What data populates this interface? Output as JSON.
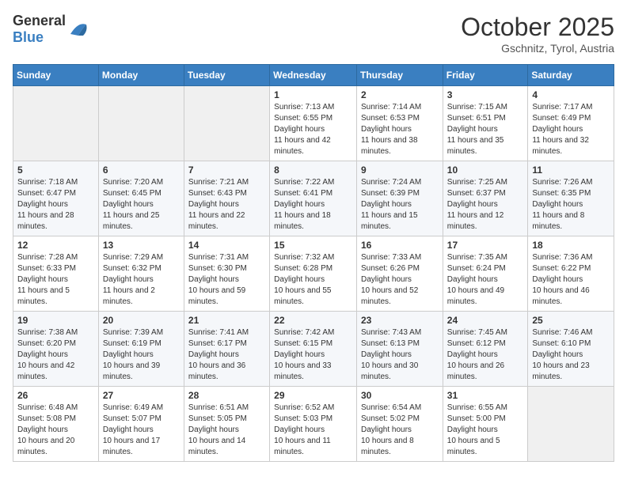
{
  "header": {
    "logo_general": "General",
    "logo_blue": "Blue",
    "month_title": "October 2025",
    "subtitle": "Gschnitz, Tyrol, Austria"
  },
  "calendar": {
    "weekdays": [
      "Sunday",
      "Monday",
      "Tuesday",
      "Wednesday",
      "Thursday",
      "Friday",
      "Saturday"
    ],
    "rows": [
      [
        {
          "day": "",
          "empty": true
        },
        {
          "day": "",
          "empty": true
        },
        {
          "day": "",
          "empty": true
        },
        {
          "day": "1",
          "sunrise": "7:13 AM",
          "sunset": "6:55 PM",
          "daylight": "11 hours and 42 minutes."
        },
        {
          "day": "2",
          "sunrise": "7:14 AM",
          "sunset": "6:53 PM",
          "daylight": "11 hours and 38 minutes."
        },
        {
          "day": "3",
          "sunrise": "7:15 AM",
          "sunset": "6:51 PM",
          "daylight": "11 hours and 35 minutes."
        },
        {
          "day": "4",
          "sunrise": "7:17 AM",
          "sunset": "6:49 PM",
          "daylight": "11 hours and 32 minutes."
        }
      ],
      [
        {
          "day": "5",
          "sunrise": "7:18 AM",
          "sunset": "6:47 PM",
          "daylight": "11 hours and 28 minutes."
        },
        {
          "day": "6",
          "sunrise": "7:20 AM",
          "sunset": "6:45 PM",
          "daylight": "11 hours and 25 minutes."
        },
        {
          "day": "7",
          "sunrise": "7:21 AM",
          "sunset": "6:43 PM",
          "daylight": "11 hours and 22 minutes."
        },
        {
          "day": "8",
          "sunrise": "7:22 AM",
          "sunset": "6:41 PM",
          "daylight": "11 hours and 18 minutes."
        },
        {
          "day": "9",
          "sunrise": "7:24 AM",
          "sunset": "6:39 PM",
          "daylight": "11 hours and 15 minutes."
        },
        {
          "day": "10",
          "sunrise": "7:25 AM",
          "sunset": "6:37 PM",
          "daylight": "11 hours and 12 minutes."
        },
        {
          "day": "11",
          "sunrise": "7:26 AM",
          "sunset": "6:35 PM",
          "daylight": "11 hours and 8 minutes."
        }
      ],
      [
        {
          "day": "12",
          "sunrise": "7:28 AM",
          "sunset": "6:33 PM",
          "daylight": "11 hours and 5 minutes."
        },
        {
          "day": "13",
          "sunrise": "7:29 AM",
          "sunset": "6:32 PM",
          "daylight": "11 hours and 2 minutes."
        },
        {
          "day": "14",
          "sunrise": "7:31 AM",
          "sunset": "6:30 PM",
          "daylight": "10 hours and 59 minutes."
        },
        {
          "day": "15",
          "sunrise": "7:32 AM",
          "sunset": "6:28 PM",
          "daylight": "10 hours and 55 minutes."
        },
        {
          "day": "16",
          "sunrise": "7:33 AM",
          "sunset": "6:26 PM",
          "daylight": "10 hours and 52 minutes."
        },
        {
          "day": "17",
          "sunrise": "7:35 AM",
          "sunset": "6:24 PM",
          "daylight": "10 hours and 49 minutes."
        },
        {
          "day": "18",
          "sunrise": "7:36 AM",
          "sunset": "6:22 PM",
          "daylight": "10 hours and 46 minutes."
        }
      ],
      [
        {
          "day": "19",
          "sunrise": "7:38 AM",
          "sunset": "6:20 PM",
          "daylight": "10 hours and 42 minutes."
        },
        {
          "day": "20",
          "sunrise": "7:39 AM",
          "sunset": "6:19 PM",
          "daylight": "10 hours and 39 minutes."
        },
        {
          "day": "21",
          "sunrise": "7:41 AM",
          "sunset": "6:17 PM",
          "daylight": "10 hours and 36 minutes."
        },
        {
          "day": "22",
          "sunrise": "7:42 AM",
          "sunset": "6:15 PM",
          "daylight": "10 hours and 33 minutes."
        },
        {
          "day": "23",
          "sunrise": "7:43 AM",
          "sunset": "6:13 PM",
          "daylight": "10 hours and 30 minutes."
        },
        {
          "day": "24",
          "sunrise": "7:45 AM",
          "sunset": "6:12 PM",
          "daylight": "10 hours and 26 minutes."
        },
        {
          "day": "25",
          "sunrise": "7:46 AM",
          "sunset": "6:10 PM",
          "daylight": "10 hours and 23 minutes."
        }
      ],
      [
        {
          "day": "26",
          "sunrise": "6:48 AM",
          "sunset": "5:08 PM",
          "daylight": "10 hours and 20 minutes."
        },
        {
          "day": "27",
          "sunrise": "6:49 AM",
          "sunset": "5:07 PM",
          "daylight": "10 hours and 17 minutes."
        },
        {
          "day": "28",
          "sunrise": "6:51 AM",
          "sunset": "5:05 PM",
          "daylight": "10 hours and 14 minutes."
        },
        {
          "day": "29",
          "sunrise": "6:52 AM",
          "sunset": "5:03 PM",
          "daylight": "10 hours and 11 minutes."
        },
        {
          "day": "30",
          "sunrise": "6:54 AM",
          "sunset": "5:02 PM",
          "daylight": "10 hours and 8 minutes."
        },
        {
          "day": "31",
          "sunrise": "6:55 AM",
          "sunset": "5:00 PM",
          "daylight": "10 hours and 5 minutes."
        },
        {
          "day": "",
          "empty": true
        }
      ]
    ]
  }
}
